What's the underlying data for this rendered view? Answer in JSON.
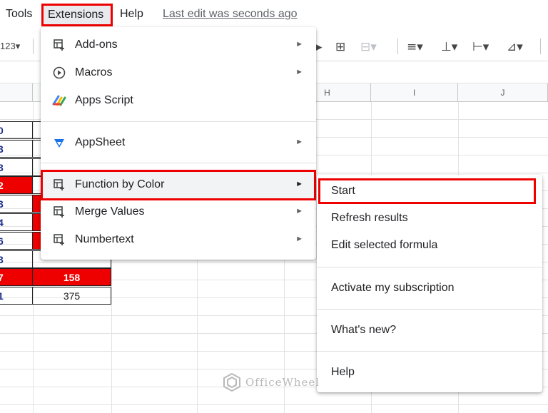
{
  "menubar": {
    "tools": "Tools",
    "extensions": "Extensions",
    "help": "Help",
    "last_edit": "Last edit was seconds ago"
  },
  "toolbar": {
    "number_format": "123"
  },
  "columns": [
    "H",
    "I",
    "J"
  ],
  "table": [
    {
      "a": "0",
      "b": "",
      "a_red": false,
      "b_red": false
    },
    {
      "a": "3",
      "b": "",
      "a_red": false,
      "b_red": false
    },
    {
      "a": "3",
      "b": "",
      "a_red": false,
      "b_red": false
    },
    {
      "a": "2",
      "b": "",
      "a_red": true,
      "b_red": false
    },
    {
      "a": "3",
      "b": "",
      "a_red": false,
      "b_red": true
    },
    {
      "a": "4",
      "b": "",
      "a_red": false,
      "b_red": true
    },
    {
      "a": "6",
      "b": "",
      "a_red": false,
      "b_red": true
    },
    {
      "a": "3",
      "b": "",
      "a_red": false,
      "b_red": false
    },
    {
      "a": "7",
      "b": "158",
      "a_red": true,
      "b_red": true
    },
    {
      "a": "1",
      "b": "375",
      "a_red": false,
      "b_red": false
    }
  ],
  "extensions_menu": {
    "items": [
      {
        "label": "Add-ons",
        "icon": "addon-icon",
        "submenu": true
      },
      {
        "label": "Macros",
        "icon": "play-circle-icon",
        "submenu": true
      },
      {
        "label": "Apps Script",
        "icon": "apps-script-icon",
        "submenu": false
      },
      {
        "label": "AppSheet",
        "icon": "appsheet-icon",
        "submenu": true
      },
      {
        "label": "Function by Color",
        "icon": "addon-icon",
        "submenu": true
      },
      {
        "label": "Merge Values",
        "icon": "addon-icon",
        "submenu": true
      },
      {
        "label": "Numbertext",
        "icon": "addon-icon",
        "submenu": true
      }
    ]
  },
  "submenu": {
    "items": [
      "Start",
      "Refresh results",
      "Edit selected formula",
      "Activate my subscription",
      "What's new?",
      "Help"
    ]
  },
  "watermark": "OfficeWheel",
  "colors": {
    "highlight": "#ee0000",
    "menu_hover": "#f1f3f4"
  }
}
